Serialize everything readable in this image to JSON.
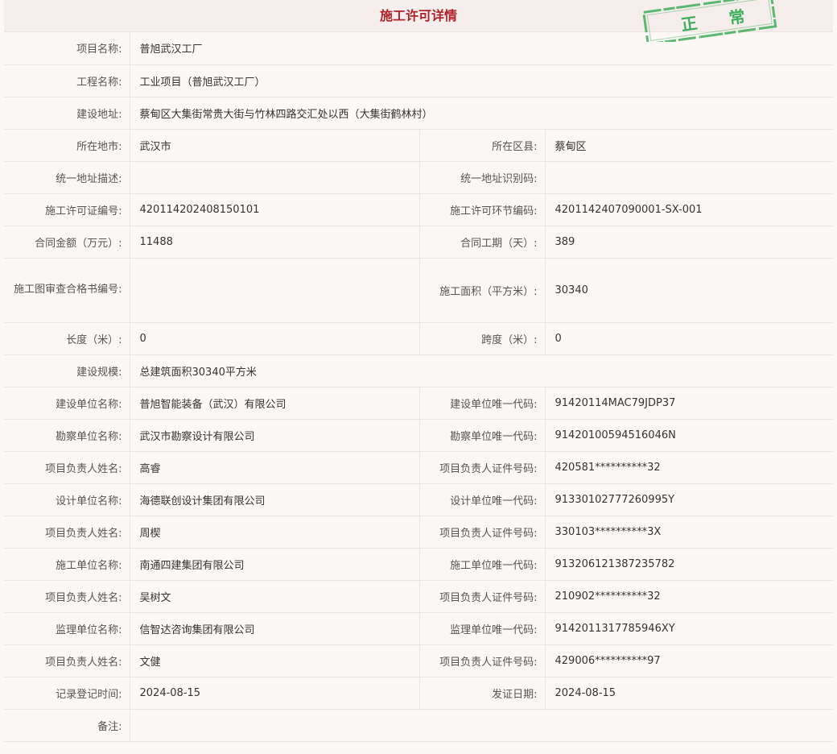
{
  "title": "施工许可详情",
  "stamp": {
    "text_left": "正",
    "text_right": "常",
    "color": "#3fae5c"
  },
  "labels": {
    "project_name": "项目名称:",
    "engineering_name": "工程名称:",
    "build_address": "建设地址:",
    "city": "所在地市:",
    "district": "所在区县:",
    "unified_address_desc": "统一地址描述:",
    "unified_address_code": "统一地址识别码:",
    "permit_number": "施工许可证编号:",
    "permit_link_code": "施工许可环节编码:",
    "contract_amount": "合同金额（万元）:",
    "contract_period": "合同工期（天）:",
    "drawing_review_no": "施工图审查合格书编号:",
    "construction_area": "施工面积（平方米）:",
    "length": "长度（米）:",
    "span": "跨度（米）:",
    "build_scale": "建设规模:",
    "builder_name": "建设单位名称:",
    "builder_code": "建设单位唯一代码:",
    "survey_name": "勘察单位名称:",
    "survey_code": "勘察单位唯一代码:",
    "pm_name": "项目负责人姓名:",
    "pm_id": "项目负责人证件号码:",
    "design_name": "设计单位名称:",
    "design_code": "设计单位唯一代码:",
    "constructor_name": "施工单位名称:",
    "constructor_code": "施工单位唯一代码:",
    "supervisor_name": "监理单位名称:",
    "supervisor_code": "监理单位唯一代码:",
    "record_time": "记录登记时间:",
    "issue_date": "发证日期:",
    "remarks": "备注:"
  },
  "values": {
    "project_name": "普旭武汉工厂",
    "engineering_name": "工业项目（普旭武汉工厂）",
    "build_address": "蔡甸区大集街常贵大街与竹林四路交汇处以西（大集街鹤林村）",
    "city": "武汉市",
    "district": "蔡甸区",
    "unified_address_desc": "",
    "unified_address_code": "",
    "permit_number": "420114202408150101",
    "permit_link_code": "4201142407090001-SX-001",
    "contract_amount": "11488",
    "contract_period": "389",
    "drawing_review_no": "",
    "construction_area": "30340",
    "length": "0",
    "span": "0",
    "build_scale": "总建筑面积30340平方米",
    "builder_name": "普旭智能装备（武汉）有限公司",
    "builder_code": "91420114MAC79JDP37",
    "survey_name": "武汉市勘察设计有限公司",
    "survey_code": "91420100594516046N",
    "survey_pm_name": "高睿",
    "survey_pm_id": "420581**********32",
    "design_name": "海德联创设计集团有限公司",
    "design_code": "91330102777260995Y",
    "design_pm_name": "周楔",
    "design_pm_id": "330103**********3X",
    "constructor_name": "南通四建集团有限公司",
    "constructor_code": "913206121387235782",
    "constructor_pm_name": "吴树文",
    "constructor_pm_id": "210902**********32",
    "supervisor_name": "信智达咨询集团有限公司",
    "supervisor_code": "9142011317785946XY",
    "supervisor_pm_name": "文健",
    "supervisor_pm_id": "429006**********97",
    "record_time": "2024-08-15",
    "issue_date": "2024-08-15",
    "remarks": ""
  }
}
